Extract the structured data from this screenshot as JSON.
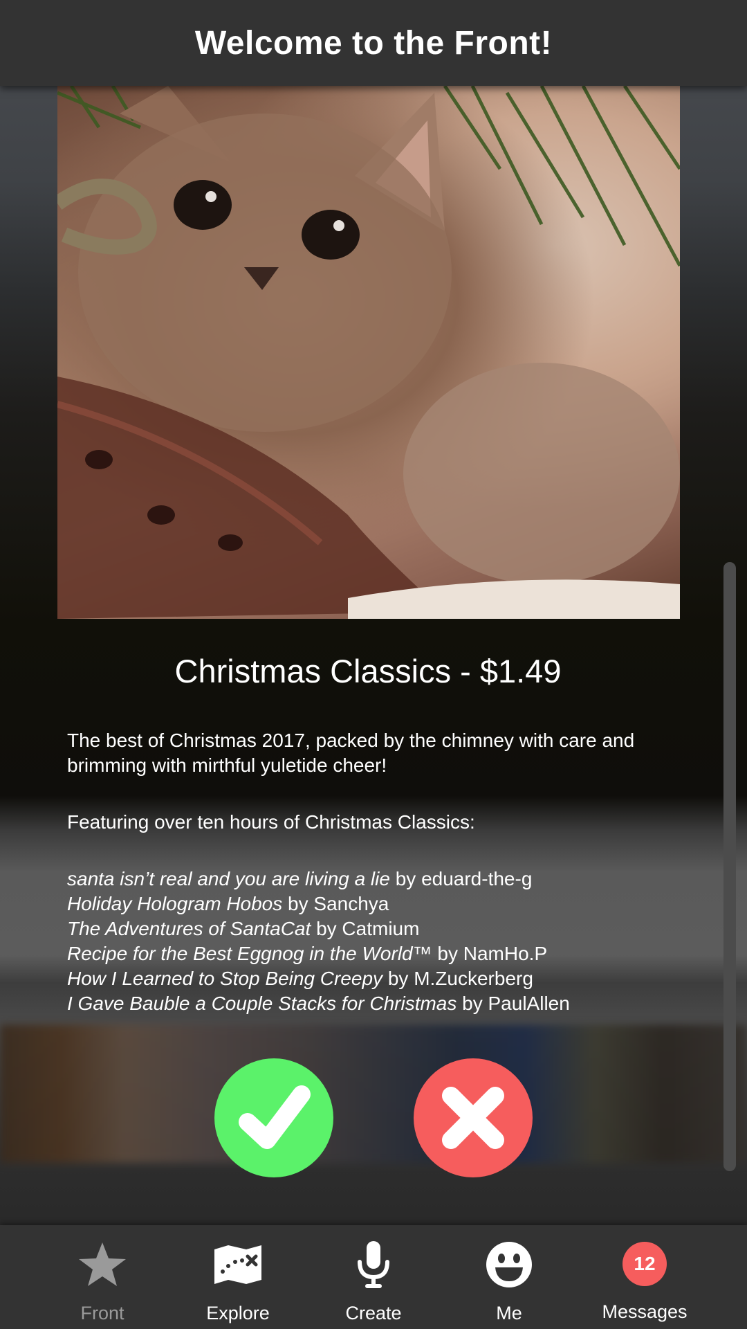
{
  "header": {
    "title": "Welcome to the Front!"
  },
  "product": {
    "title": "Christmas Classics - $1.49",
    "description": "The best of Christmas 2017, packed by the chimney with care and brimming with mirthful yuletide cheer!",
    "featuring": "Featuring over ten hours of Christmas Classics:",
    "tracks": [
      {
        "title": "santa isn’t real and you are living a lie",
        "by": " by eduard-the-g"
      },
      {
        "title": "Holiday Hologram Hobos",
        "by": " by Sanchya"
      },
      {
        "title": "The Adventures of SantaCat",
        "by": " by Catmium"
      },
      {
        "title": "Recipe for the Best Eggnog in the World™",
        "by": " by NamHo.P"
      },
      {
        "title": "How I Learned to Stop Being Creepy",
        "by": " by M.Zuckerberg"
      },
      {
        "title": "I Gave Bauble a Couple Stacks for Christmas",
        "by": " by PaulAllen"
      }
    ]
  },
  "actions": {
    "accept_icon": "checkmark-icon",
    "reject_icon": "x-icon"
  },
  "tabs": [
    {
      "label": "Front",
      "icon": "star-icon",
      "active": true
    },
    {
      "label": "Explore",
      "icon": "map-icon"
    },
    {
      "label": "Create",
      "icon": "microphone-icon"
    },
    {
      "label": "Me",
      "icon": "smiley-icon"
    },
    {
      "label": "Messages",
      "icon": "badge",
      "badge_count": "12"
    }
  ],
  "colors": {
    "header_bg": "#333333",
    "accept": "#5bf26a",
    "reject": "#f65d5d",
    "inactive_tab": "#9a9a9a",
    "badge": "#f65d5d"
  }
}
